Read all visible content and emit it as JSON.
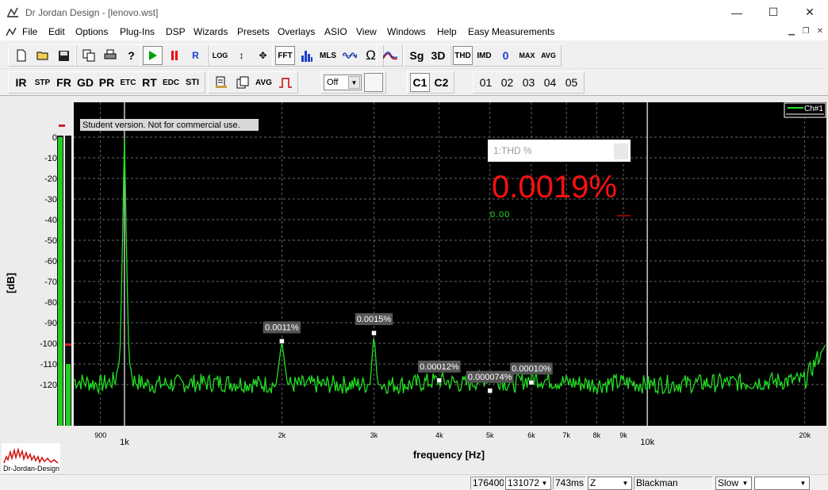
{
  "window": {
    "title": "Dr Jordan Design - [lenovo.wst]",
    "minimize": "—",
    "maximize": "☐",
    "close": "✕"
  },
  "menu": [
    "File",
    "Edit",
    "Options",
    "Plug-Ins",
    "DSP",
    "Wizards",
    "Presets",
    "Overlays",
    "ASIO",
    "View",
    "Windows",
    "Help",
    "Easy Measurements"
  ],
  "toolbar1": {
    "new_icon": "new-document-icon",
    "open_icon": "open-folder-icon",
    "save_icon": "save-disk-icon",
    "copy_icon": "copy-icon",
    "print_icon": "print-icon",
    "help_icon": "help-question-icon",
    "play_icon": "play-icon",
    "pause_icon": "pause-icon",
    "record_label": "R",
    "log_label": "LOG",
    "fft_label": "FFT",
    "mls_label": "MLS",
    "omega_label": "Ω",
    "sg_label": "Sg",
    "threed_label": "3D",
    "thd_label": "THD",
    "imd_label": "IMD",
    "zero_label": "0",
    "max_label": "MAX",
    "avg_label": "AVG"
  },
  "toolbar2": {
    "buttons": [
      "IR",
      "STP",
      "FR",
      "GD",
      "PR",
      "ETC",
      "RT",
      "EDC",
      "STI"
    ],
    "avg_label": "AVG",
    "off_select": "Off",
    "channels": [
      "C1",
      "C2"
    ],
    "presets": [
      "01",
      "02",
      "03",
      "04",
      "05"
    ]
  },
  "plot": {
    "student_notice": "Student version. Not for commercial use.",
    "legend_label": "Ch#1",
    "y_axis_label": "[dB]",
    "x_axis_label": "frequency [Hz]",
    "y_ticks": [
      "0",
      "-10",
      "-20",
      "-30",
      "-40",
      "-50",
      "-60",
      "-70",
      "-80",
      "-90",
      "-100",
      "-110",
      "-120"
    ],
    "x_ticks": [
      "900",
      "1k",
      "2k",
      "3k",
      "4k",
      "5k",
      "6k",
      "7k",
      "8k",
      "9k",
      "10k",
      "20k"
    ],
    "thd_panel_title": "1:THD %",
    "thd_value": "0.0019%",
    "thd_sub": "0.00",
    "harmonic_labels": [
      "0.0011%",
      "0.0015%",
      "0.00012%",
      "0.000074%",
      "0.00010%"
    ],
    "logo_text": "Dr-Jordan-Design",
    "colors": {
      "trace": "#22e022",
      "thd": "#ff1010",
      "background": "#000000",
      "grid": "#8a8a8a"
    }
  },
  "chart_data": {
    "type": "line",
    "xlabel": "frequency [Hz]",
    "ylabel": "[dB]",
    "xscale": "log",
    "xlim": [
      800,
      22000
    ],
    "ylim": [
      -135,
      5
    ],
    "series": [
      {
        "name": "Ch#1",
        "x": [
          800,
          900,
          960,
          980,
          990,
          1000,
          1010,
          1020,
          1040,
          1100,
          1500,
          1950,
          2000,
          2050,
          2500,
          2950,
          3000,
          3050,
          3500,
          4000,
          4500,
          5000,
          5500,
          6000,
          7000,
          8000,
          9000,
          10000,
          15000,
          20000,
          22000
        ],
        "y": [
          -118,
          -120,
          -118,
          -108,
          -60,
          0,
          -60,
          -108,
          -118,
          -120,
          -119,
          -120,
          -99,
          -120,
          -120,
          -120,
          -95,
          -120,
          -120,
          -118,
          -120,
          -116,
          -120,
          -117,
          -119,
          -120,
          -119,
          -120,
          -119,
          -118,
          -100
        ]
      }
    ],
    "harmonics": [
      {
        "x": 2000,
        "y": -99,
        "label": "0.0011%"
      },
      {
        "x": 3000,
        "y": -95,
        "label": "0.0015%"
      },
      {
        "x": 4000,
        "y": -118,
        "label": "0.00012%"
      },
      {
        "x": 5000,
        "y": -123,
        "label": "0.000074%"
      },
      {
        "x": 6000,
        "y": -119,
        "label": "0.00010%"
      }
    ],
    "level_meter": {
      "channel1_db": 0,
      "channel2_db": -110,
      "peak1_db": 0,
      "peak2_db": -82
    },
    "grid": true,
    "legend": "top-right"
  },
  "status": {
    "sample_rate": "176400",
    "fft_size": "131072",
    "duration": "743ms",
    "weighting": "Z",
    "window": "Blackman",
    "speed": "Slow",
    "extra": ""
  }
}
